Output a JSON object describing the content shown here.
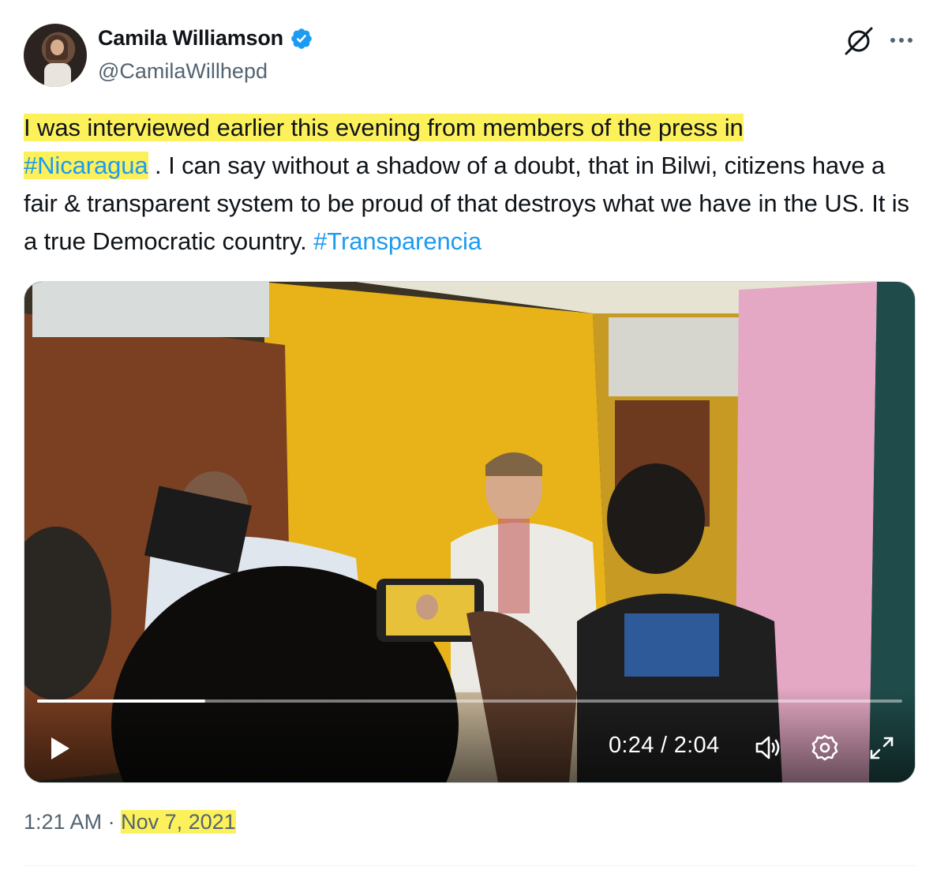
{
  "author": {
    "name": "Camila Williamson",
    "handle": "@CamilaWillhepd",
    "verified": true,
    "avatar_icon": "user-avatar"
  },
  "icons": {
    "verified": "verified-badge-icon",
    "grok": "grok-icon",
    "more": "more-icon",
    "play": "play-icon",
    "volume": "volume-icon",
    "settings": "settings-icon",
    "fullscreen": "fullscreen-icon"
  },
  "tweet": {
    "text_highlighted_1": "I was interviewed earlier this evening from members of the press in",
    "hashtag_1": "#Nicaragua",
    "text_2": " . I can say without a shadow of a doubt, that in Bilwi, citizens have a fair & transparent system to be proud of that destroys what we have in the US. It is a true Democratic country. ",
    "hashtag_2": "#Transparencia"
  },
  "video": {
    "current_time": "0:24",
    "separator": "/",
    "duration": "2:04",
    "progress_fraction": 0.194
  },
  "footer": {
    "time": "1:21 AM",
    "dot": "·",
    "date": "Nov 7, 2021"
  },
  "colors": {
    "highlight": "#fdf15b",
    "link": "#1d9bf0",
    "verified": "#1d9bf0",
    "secondary_text": "#536471"
  }
}
